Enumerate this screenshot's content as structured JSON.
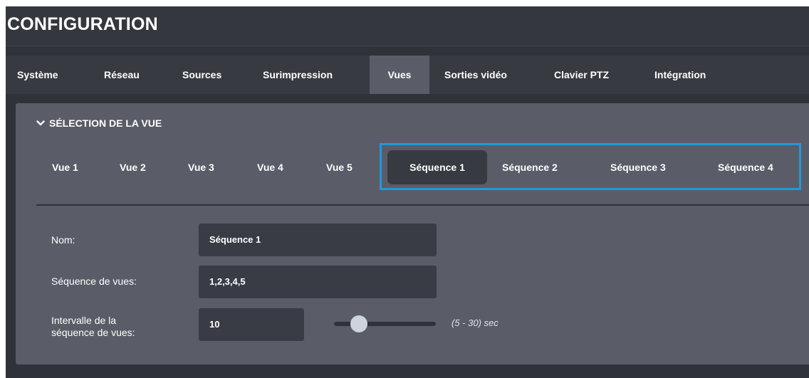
{
  "app": {
    "title": "CONFIGURATION"
  },
  "tabs": [
    {
      "label": "Système",
      "active": false
    },
    {
      "label": "Réseau",
      "active": false
    },
    {
      "label": "Sources",
      "active": false
    },
    {
      "label": "Surimpression",
      "active": false
    },
    {
      "label": "Vues",
      "active": true
    },
    {
      "label": "Sorties vidéo",
      "active": false
    },
    {
      "label": "Clavier PTZ",
      "active": false
    },
    {
      "label": "Intégration",
      "active": false
    }
  ],
  "section": {
    "title": "SÉLECTION DE LA VUE",
    "icon": "chevron-down-icon"
  },
  "views": [
    {
      "label": "Vue 1",
      "active": false
    },
    {
      "label": "Vue 2",
      "active": false
    },
    {
      "label": "Vue 3",
      "active": false
    },
    {
      "label": "Vue 4",
      "active": false
    },
    {
      "label": "Vue 5",
      "active": false
    },
    {
      "label": "Séquence 1",
      "active": true
    },
    {
      "label": "Séquence 2",
      "active": false
    },
    {
      "label": "Séquence 3",
      "active": false
    },
    {
      "label": "Séquence 4",
      "active": false
    }
  ],
  "form": {
    "name": {
      "label": "Nom:",
      "value": "Séquence 1"
    },
    "sequence": {
      "label": "Séquence de vues:",
      "value": "1,2,3,4,5"
    },
    "interval": {
      "label_line1": "Intervalle de la",
      "label_line2": "séquence de vues:",
      "value": "10",
      "range_note": "(5 - 30) sec",
      "slider_min": 5,
      "slider_max": 30,
      "slider_value": 10
    }
  },
  "colors": {
    "highlight_border": "#1f98dc",
    "panel_bg": "#5a5d67",
    "app_bg": "#2f3238",
    "input_bg": "#393c44"
  }
}
